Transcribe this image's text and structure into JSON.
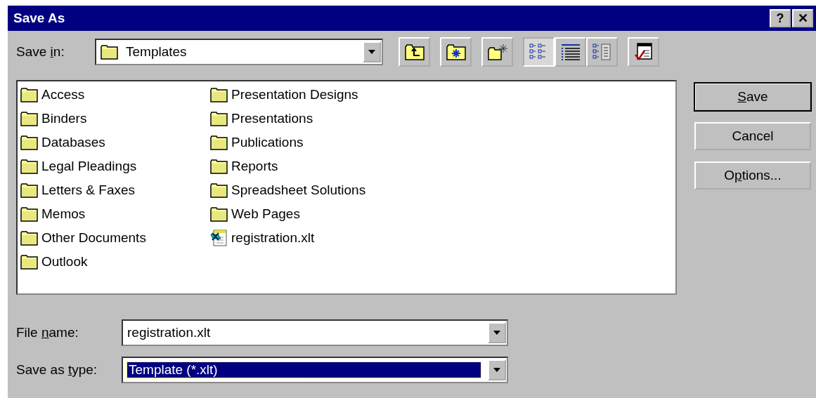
{
  "window": {
    "title": "Save As",
    "title_buttons": [
      "?",
      "✕"
    ]
  },
  "save_in": {
    "label": {
      "pre": "Save ",
      "key": "i",
      "post": "n:"
    },
    "value": "Templates"
  },
  "toolbar": [
    {
      "kind": "up-folder"
    },
    {
      "kind": "favorites"
    },
    {
      "kind": "new-folder"
    },
    {
      "kind": "list-view",
      "selected": true
    },
    {
      "kind": "details-view",
      "selected": false
    },
    {
      "kind": "properties-view",
      "selected": false
    },
    {
      "kind": "tools"
    }
  ],
  "files": [
    {
      "kind": "folder",
      "name": "Access"
    },
    {
      "kind": "folder",
      "name": "Binders"
    },
    {
      "kind": "folder",
      "name": "Databases"
    },
    {
      "kind": "folder",
      "name": "Legal Pleadings"
    },
    {
      "kind": "folder",
      "name": "Letters & Faxes"
    },
    {
      "kind": "folder",
      "name": "Memos"
    },
    {
      "kind": "folder",
      "name": "Other Documents"
    },
    {
      "kind": "folder",
      "name": "Outlook"
    },
    {
      "kind": "folder",
      "name": "Presentation Designs"
    },
    {
      "kind": "folder",
      "name": "Presentations"
    },
    {
      "kind": "folder",
      "name": "Publications"
    },
    {
      "kind": "folder",
      "name": "Reports"
    },
    {
      "kind": "folder",
      "name": "Spreadsheet Solutions"
    },
    {
      "kind": "folder",
      "name": "Web Pages"
    },
    {
      "kind": "template",
      "name": "registration.xlt"
    }
  ],
  "buttons": [
    {
      "label": {
        "key": "S",
        "post": "ave"
      },
      "default": true
    },
    {
      "label": {
        "pre": "Cancel"
      },
      "default": false
    },
    {
      "label": {
        "pre": "O",
        "key": "p",
        "post": "tions..."
      },
      "default": false
    }
  ],
  "file_name": {
    "label": {
      "pre": "File ",
      "key": "n",
      "post": "ame:"
    },
    "value": "registration.xlt",
    "selected": false
  },
  "save_as_type": {
    "label": {
      "pre": "Save as ",
      "key": "t",
      "post": "ype:"
    },
    "value": "Template (*.xlt)",
    "selected": true
  }
}
